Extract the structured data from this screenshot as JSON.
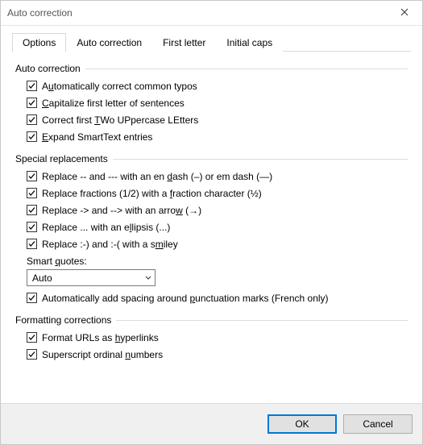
{
  "window": {
    "title": "Auto correction"
  },
  "tabs": {
    "options": "Options",
    "autocorr": "Auto correction",
    "first": "First letter",
    "caps": "Initial caps"
  },
  "groups": {
    "auto": {
      "title": "Auto correction",
      "typos_pre": "A",
      "typos_u": "u",
      "typos_post": "tomatically correct common typos",
      "caps_pre": "",
      "caps_u": "C",
      "caps_post": "apitalize first letter of sentences",
      "two_pre": "Correct first ",
      "two_u": "T",
      "two_post": "Wo UPpercase LEtters",
      "smart_pre": "",
      "smart_u": "E",
      "smart_post": "xpand SmartText entries"
    },
    "special": {
      "title": "Special replacements",
      "dash_pre": "Replace -- and --- with an en ",
      "dash_u": "d",
      "dash_post": "ash (–) or em dash (—)",
      "frac_pre": "Replace fractions (1/2) with a ",
      "frac_u": "f",
      "frac_post": "raction character (½)",
      "arrow_pre": "Replace -> and --> with an arro",
      "arrow_u": "w",
      "arrow_post": " (→)",
      "ell_pre": "Replace ... with an e",
      "ell_u": "l",
      "ell_post": "lipsis (...)",
      "smile_pre": "Replace :-) and :-( with a s",
      "smile_u": "m",
      "smile_post": "iley",
      "sq_label_pre": "Smart ",
      "sq_label_u": "q",
      "sq_label_post": "uotes:",
      "sq_value": "Auto",
      "punct_pre": "Automatically add spacing around ",
      "punct_u": "p",
      "punct_post": "unctuation marks (French only)"
    },
    "fmt": {
      "title": "Formatting corrections",
      "url_pre": "Format URLs as ",
      "url_u": "h",
      "url_post": "yperlinks",
      "sup_pre": "Superscript ordinal ",
      "sup_u": "n",
      "sup_post": "umbers"
    }
  },
  "buttons": {
    "ok": "OK",
    "cancel": "Cancel"
  }
}
